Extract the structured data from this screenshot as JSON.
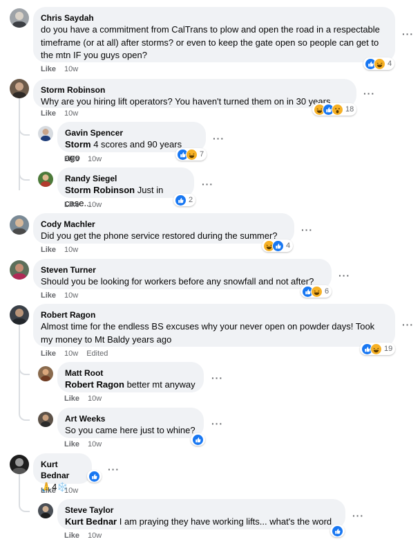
{
  "comments": [
    {
      "author": "Chris Saydah",
      "mention": "",
      "text": "do you have a commitment from CalTrans to plow and open the road in a respectable timeframe (or at all) after storms? or even to keep the gate open so people can get to the mtn IF you guys open?",
      "like": "Like",
      "time": "10w",
      "edited": "",
      "reactions": [
        "like",
        "haha"
      ],
      "count": "4"
    },
    {
      "author": "Storm Robinson",
      "mention": "",
      "text": "Why are you hiring lift operators? You haven't turned them on in 30 years...",
      "like": "Like",
      "time": "10w",
      "edited": "",
      "reactions": [
        "haha",
        "like",
        "wow"
      ],
      "count": "18"
    },
    {
      "author": "Gavin Spencer",
      "mention": "Storm",
      "text": "4 scores and 90 years ago",
      "like": "Like",
      "time": "10w",
      "edited": "",
      "reactions": [
        "like",
        "haha"
      ],
      "count": "7"
    },
    {
      "author": "Randy Siegel",
      "mention": "Storm Robinson",
      "text": "Just in case...",
      "like": "Like",
      "time": "10w",
      "edited": "",
      "reactions": [
        "like"
      ],
      "count": "2"
    },
    {
      "author": "Cody Machler",
      "mention": "",
      "text": "Did you get the phone service restored during the summer?",
      "like": "Like",
      "time": "10w",
      "edited": "",
      "reactions": [
        "haha",
        "like"
      ],
      "count": "4"
    },
    {
      "author": "Steven Turner",
      "mention": "",
      "text": "Should you be looking for workers before any snowfall and not after?",
      "like": "Like",
      "time": "10w",
      "edited": "",
      "reactions": [
        "like",
        "haha"
      ],
      "count": "6"
    },
    {
      "author": "Robert Ragon",
      "mention": "",
      "text": "Almost time for the endless BS excuses why your never open on powder days! Took my money to Mt Baldy years ago",
      "like": "Like",
      "time": "10w",
      "edited": "Edited",
      "reactions": [
        "like",
        "haha"
      ],
      "count": "19"
    },
    {
      "author": "Matt Root",
      "mention": "Robert Ragon",
      "text": "better mt anyway",
      "like": "Like",
      "time": "10w",
      "edited": "",
      "reactions": [],
      "count": ""
    },
    {
      "author": "Art Weeks",
      "mention": "",
      "text": "So you came here just to whine?",
      "like": "Like",
      "time": "10w",
      "edited": "",
      "reactions": [
        "like"
      ],
      "count": ""
    },
    {
      "author": "Kurt Bednar",
      "mention": "",
      "text": "🙏4❄️",
      "like": "Like",
      "time": "10w",
      "edited": "",
      "reactions": [
        "like"
      ],
      "count": ""
    },
    {
      "author": "Steve Taylor",
      "mention": "Kurt Bednar",
      "text": "I am praying they have working lifts... what's the word",
      "like": "Like",
      "time": "10w",
      "edited": "",
      "reactions": [
        "like"
      ],
      "count": ""
    }
  ],
  "more_icon": "more-options-icon",
  "colors": {
    "bubble": "#f0f2f5",
    "like_blue": "#1877f2",
    "haha_yellow": "#f7b125",
    "meta": "#65676b"
  }
}
